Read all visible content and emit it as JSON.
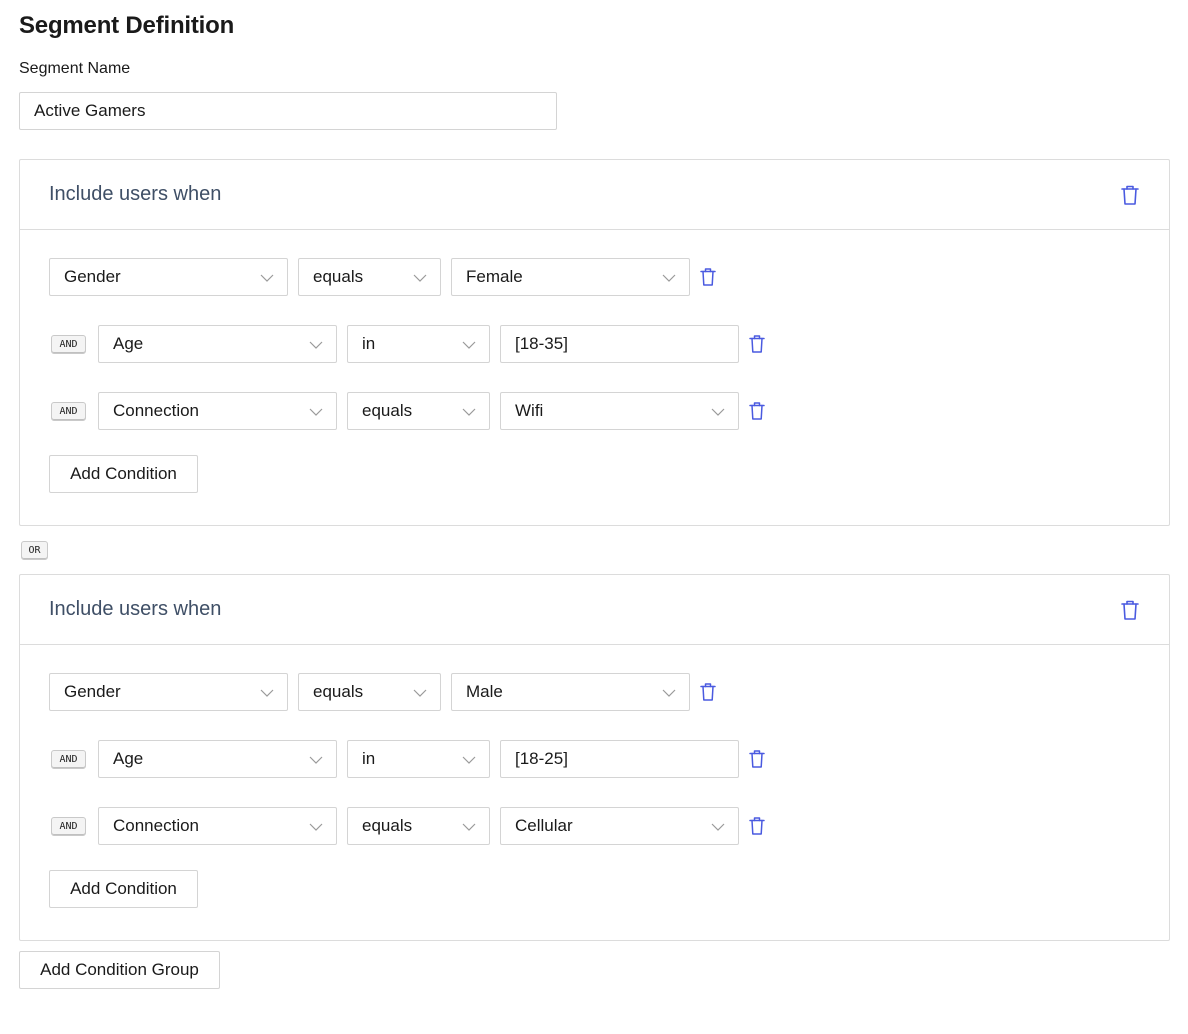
{
  "page": {
    "title": "Segment Definition"
  },
  "segment": {
    "name_label": "Segment Name",
    "name_value": "Active Gamers"
  },
  "colors": {
    "accent": "#4a5ae0",
    "group_title": "#3f4f66",
    "border": "#dcdcdc"
  },
  "icons": {
    "delete": "trash-icon",
    "dropdown": "chevron-down-icon"
  },
  "connector_or": "OR",
  "groups": [
    {
      "title": "Include users when",
      "rows": [
        {
          "attribute": "Gender",
          "operator": "equals",
          "value": "Female",
          "value_type": "select"
        },
        {
          "connector": "AND",
          "attribute": "Age",
          "operator": "in",
          "value": "[18-35]",
          "value_type": "input"
        },
        {
          "connector": "AND",
          "attribute": "Connection",
          "operator": "equals",
          "value": "Wifi",
          "value_type": "select"
        }
      ],
      "add_condition_label": "Add Condition"
    },
    {
      "title": "Include users when",
      "rows": [
        {
          "attribute": "Gender",
          "operator": "equals",
          "value": "Male",
          "value_type": "select"
        },
        {
          "connector": "AND",
          "attribute": "Age",
          "operator": "in",
          "value": "[18-25]",
          "value_type": "input"
        },
        {
          "connector": "AND",
          "attribute": "Connection",
          "operator": "equals",
          "value": "Cellular",
          "value_type": "select"
        }
      ],
      "add_condition_label": "Add Condition"
    }
  ],
  "add_group_label": "Add Condition Group"
}
